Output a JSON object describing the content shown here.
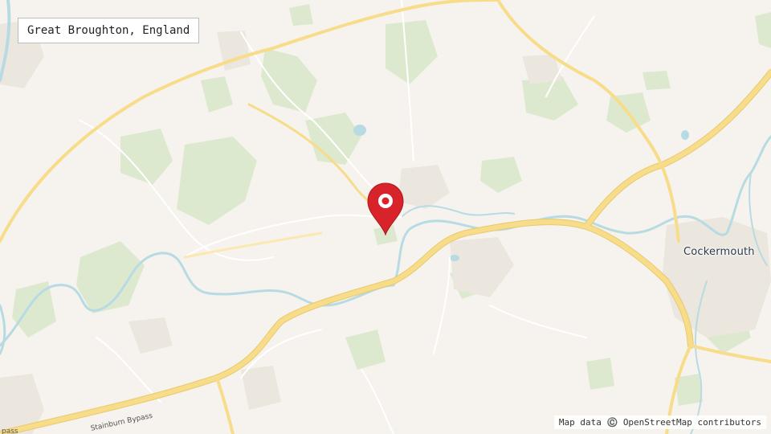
{
  "location_label": "Great Broughton, England",
  "attribution": "Map data ©️ OpenStreetMap contributors",
  "places": {
    "town": "Cockermouth"
  },
  "roads": {
    "bypass": "Stainburn Bypass",
    "edge_fragment": "pass"
  },
  "icons": {
    "marker": "map-pin-icon"
  },
  "colors": {
    "land": "#f6f3ee",
    "vegetation": "#dde9cf",
    "water": "#b8dbe3",
    "road_major": "#f7dc8a",
    "road_minor": "#ffffff",
    "urban": "#ebe6de",
    "marker": "#d8232a"
  }
}
